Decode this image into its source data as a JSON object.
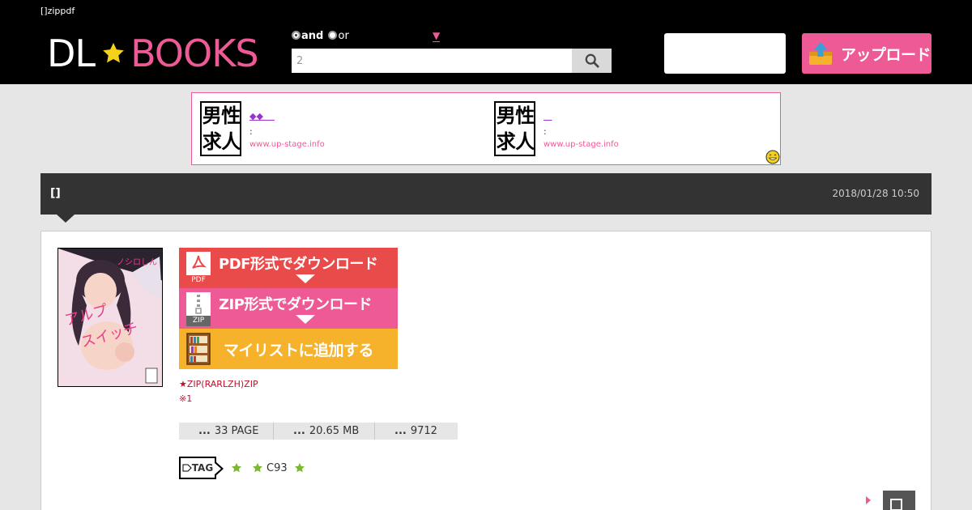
{
  "header": {
    "tagline": "[]zippdf",
    "logo_left": "DL",
    "logo_right": "BOOKS",
    "search": {
      "opt_and": "and",
      "opt_or": "or",
      "dropdown": "▼",
      "value": "2"
    },
    "upload_label": "アップロード"
  },
  "ads": [
    {
      "logo": [
        "男",
        "性",
        "求",
        "人"
      ],
      "title": "◆◆",
      "desc": ":",
      "url": "www.up-stage.info"
    },
    {
      "logo": [
        "男",
        "性",
        "求",
        "人"
      ],
      "title": "",
      "desc": ":",
      "url": "www.up-stage.info"
    }
  ],
  "post": {
    "title": "[]",
    "date": "2018/01/28 10:50",
    "cover_alt": "アルプ・スイッチ",
    "buttons": {
      "pdf_label": "PDF形式でダウンロード",
      "pdf_tag": "PDF",
      "zip_label": "ZIP形式でダウンロード",
      "zip_tag": "ZIP",
      "mylist_label": "マイリストに追加する"
    },
    "note1": "★ZIP(RARLZH)ZIP",
    "note2": "※1",
    "stats": {
      "pages": "33 PAGE",
      "size": "20.65 MB",
      "views": "9712",
      "dots": "..."
    },
    "tag_label": "TAG",
    "tags": [
      "",
      "C93",
      ""
    ]
  },
  "colors": {
    "brand_pink": "#ee5a95",
    "pdf_red": "#e94a4a",
    "mylist_orange": "#f5b22a",
    "tag_green": "#7cb82f"
  }
}
